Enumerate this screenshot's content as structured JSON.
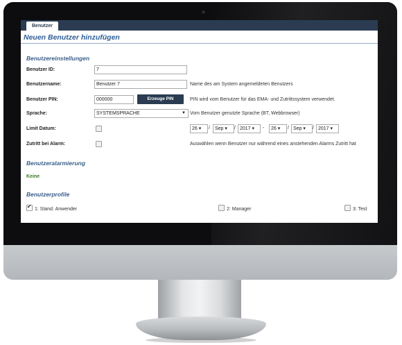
{
  "tabs": [
    {
      "label": "Benutzer"
    }
  ],
  "page_title": "Neuen Benutzer hinzufügen",
  "sections": {
    "settings": "Benutzereinstellungen",
    "alarming": "Benutzeralarmierung",
    "profiles": "Benutzerprofile"
  },
  "fields": {
    "user_id": {
      "label": "Benutzer ID:",
      "value": "7"
    },
    "user_name": {
      "label": "Benutzername:",
      "value": "Benutzer 7",
      "description": "Name des am System angemeldeten Benutzers"
    },
    "user_pin": {
      "label": "Benutzer PIN:",
      "value": "000000",
      "button": "Erzeuge PIN",
      "description": "PIN wird vom Benutzer für das EMA- und Zutrittssystem verwendet."
    },
    "language": {
      "label": "Sprache:",
      "value": "SYSTEMSPRACHE",
      "description": "Vom Benutzer genutzte Sprache (BT, Webbrowser)"
    },
    "limit_date": {
      "label": "Limit Datum:",
      "checked": false,
      "from": {
        "day": "26",
        "month": "Sep",
        "year": "2017"
      },
      "to": {
        "day": "26",
        "month": "Sep",
        "year": "2017"
      },
      "slash": "/",
      "dash": "-"
    },
    "alarm_access": {
      "label": "Zutritt bei Alarm:",
      "checked": false,
      "description": "Auswählen wenn Benutzer nur während eines anstehenden Alarms Zutritt hat"
    }
  },
  "alarming_value": "Keine",
  "profiles": [
    {
      "label": "1: Stand. Anwender",
      "checked": true
    },
    {
      "label": "2: Manager",
      "checked": false
    },
    {
      "label": "3: Test",
      "checked": false
    }
  ],
  "colors": {
    "accent": "#2e5f97",
    "header": "#2b3c52",
    "ok": "#3a7a22"
  }
}
